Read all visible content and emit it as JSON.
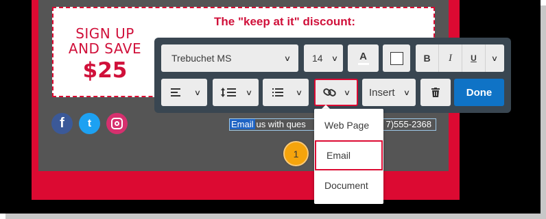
{
  "promo": {
    "line1": "SIGN UP",
    "line2": "AND SAVE",
    "amount": "$25",
    "title": "The \"keep at it\" discount:"
  },
  "social": {
    "facebook_glyph": "f",
    "twitter_glyph": "t"
  },
  "email_line": {
    "selected_text": "Email",
    "rest_text": "us with ques",
    "tail_text": "7)555-2368"
  },
  "toolbar": {
    "font_family": "Trebuchet MS",
    "font_size": "14",
    "color_glyph": "A",
    "bold": "B",
    "italic": "I",
    "underline": "U",
    "insert_label": "Insert",
    "done_label": "Done"
  },
  "link_menu": {
    "items": [
      "Web Page",
      "Email",
      "Document"
    ],
    "selected": "Email"
  },
  "callout": {
    "number": "1"
  },
  "colors": {
    "brand_red": "#dc0a32",
    "toolbar_bg": "#394651",
    "done_blue": "#0f73c6",
    "callout_orange": "#f5a40c"
  }
}
